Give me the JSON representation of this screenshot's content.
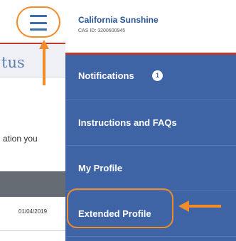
{
  "background_page": {
    "title_fragment": "tus",
    "text_fragment": "ation you",
    "date": "01/04/2019"
  },
  "drawer": {
    "user_name": "California Sunshine",
    "user_id": "CAS ID: 3200600945",
    "notification_count": "1",
    "items": [
      {
        "label": "Notifications"
      },
      {
        "label": "Instructions and FAQs"
      },
      {
        "label": "My Profile"
      },
      {
        "label": "Extended Profile"
      }
    ]
  },
  "icons": {
    "menu": "hamburger-menu-icon",
    "arrow_up": "arrow-up-icon",
    "arrow_left": "arrow-left-icon"
  },
  "colors": {
    "nav_background": "#3e64a6",
    "highlight": "#f28c28",
    "accent_red": "#c0392b",
    "name_blue": "#2a5596"
  }
}
